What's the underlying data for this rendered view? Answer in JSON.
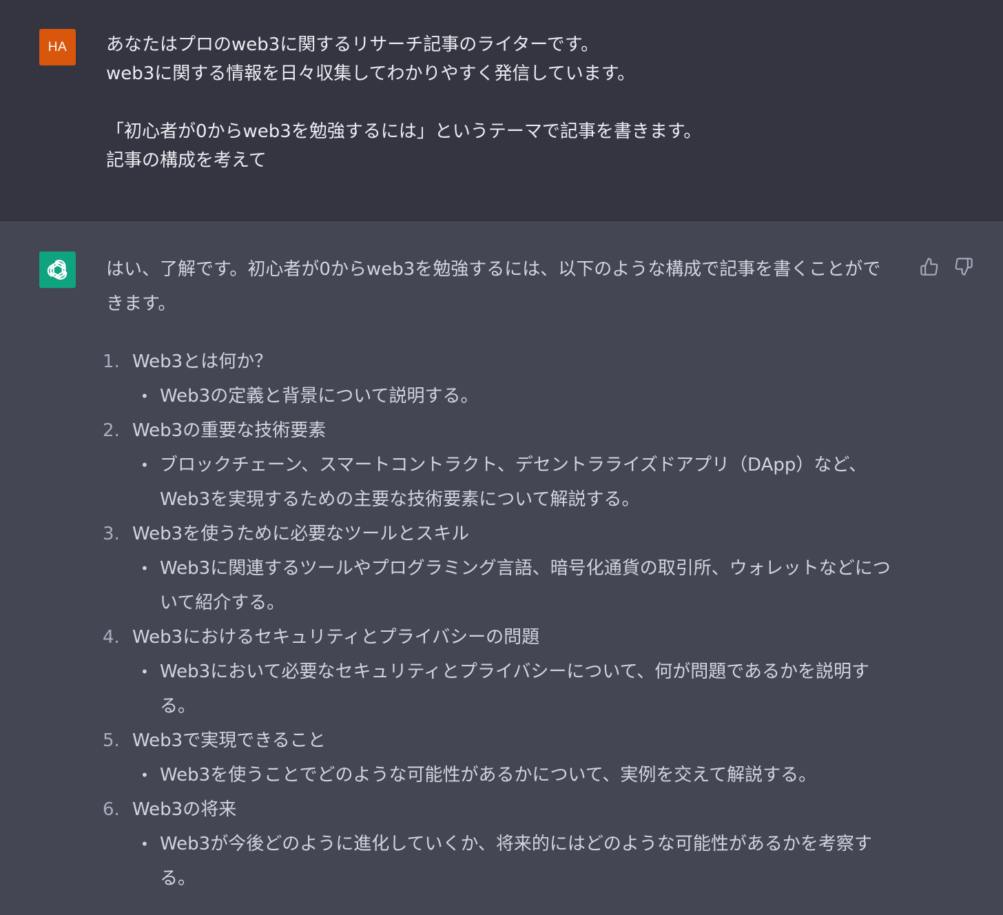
{
  "user": {
    "avatar_initials": "HA",
    "avatar_color": "#d9560d",
    "lines": [
      "あなたはプロのweb3に関するリサーチ記事のライターです。",
      "web3に関する情報を日々収集してわかりやすく発信しています。",
      "",
      "「初心者が0からweb3を勉強するには」というテーマで記事を書きます。",
      "記事の構成を考えて"
    ]
  },
  "assistant": {
    "avatar_icon": "openai-logo-icon",
    "avatar_color": "#10a37f",
    "intro": "はい、了解です。初心者が0からweb3を勉強するには、以下のような構成で記事を書くことができます。",
    "items": [
      {
        "num": "1.",
        "title": "Web3とは何か？",
        "detail": "Web3の定義と背景について説明する。"
      },
      {
        "num": "2.",
        "title": "Web3の重要な技術要素",
        "detail": "ブロックチェーン、スマートコントラクト、デセントラライズドアプリ（DApp）など、Web3を実現するための主要な技術要素について解説する。"
      },
      {
        "num": "3.",
        "title": "Web3を使うために必要なツールとスキル",
        "detail": "Web3に関連するツールやプログラミング言語、暗号化通貨の取引所、ウォレットなどについて紹介する。"
      },
      {
        "num": "4.",
        "title": "Web3におけるセキュリティとプライバシーの問題",
        "detail": "Web3において必要なセキュリティとプライバシーについて、何が問題であるかを説明する。"
      },
      {
        "num": "5.",
        "title": "Web3で実現できること",
        "detail": "Web3を使うことでどのような可能性があるかについて、実例を交えて解説する。"
      },
      {
        "num": "6.",
        "title": "Web3の将来",
        "detail": "Web3が今後どのように進化していくか、将来的にはどのような可能性があるかを考察する。"
      }
    ]
  },
  "feedback": {
    "thumbs_up_icon": "thumbs-up-icon",
    "thumbs_down_icon": "thumbs-down-icon"
  },
  "colors": {
    "user_bg": "#343541",
    "assistant_bg": "#444654",
    "text": "#d1d5db"
  }
}
